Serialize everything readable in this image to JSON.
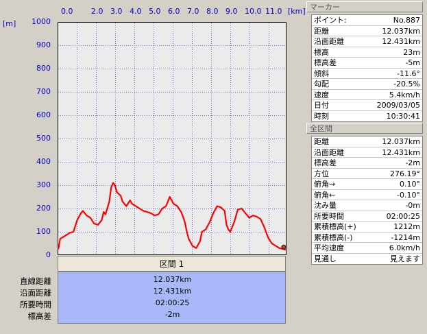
{
  "chart": {
    "unit_x": "[km]",
    "unit_y": "[m]",
    "x_ticks": [
      "0.0",
      "2.0",
      "3.0",
      "4.0",
      "5.0",
      "6.0",
      "7.0",
      "8.0",
      "9.0",
      "10.0",
      "11.0"
    ],
    "y_ticks": [
      "1000",
      "900",
      "800",
      "700",
      "600",
      "500",
      "400",
      "300",
      "200",
      "100",
      "0"
    ],
    "line_color": "#ff0000",
    "grid_color": "#6f6fd8",
    "plot_bg": "#ebebeb"
  },
  "chart_data": {
    "type": "line",
    "xlabel": "[km]",
    "ylabel": "[m]",
    "ylim": [
      0,
      1000
    ],
    "xlim": [
      0,
      12.037
    ],
    "x": [
      0.0,
      0.1,
      0.3,
      0.6,
      0.8,
      1.0,
      1.2,
      1.3,
      1.5,
      1.7,
      1.9,
      2.1,
      2.3,
      2.4,
      2.5,
      2.7,
      2.8,
      2.9,
      3.0,
      3.1,
      3.3,
      3.4,
      3.6,
      3.8,
      3.9,
      4.1,
      4.3,
      4.5,
      4.7,
      4.9,
      5.1,
      5.3,
      5.5,
      5.7,
      5.9,
      6.1,
      6.3,
      6.5,
      6.6,
      6.7,
      6.8,
      6.9,
      7.1,
      7.3,
      7.5,
      7.6,
      7.7,
      7.8,
      8.0,
      8.2,
      8.4,
      8.6,
      8.8,
      8.9,
      9.0,
      9.1,
      9.3,
      9.5,
      9.7,
      9.9,
      10.1,
      10.3,
      10.5,
      10.7,
      10.9,
      11.1,
      11.3,
      11.5,
      11.7,
      11.9,
      12.037
    ],
    "y": [
      25,
      70,
      80,
      95,
      100,
      150,
      180,
      190,
      170,
      160,
      135,
      130,
      150,
      185,
      175,
      230,
      290,
      310,
      300,
      270,
      255,
      230,
      210,
      235,
      220,
      210,
      200,
      190,
      185,
      180,
      170,
      175,
      200,
      210,
      250,
      220,
      210,
      185,
      165,
      140,
      100,
      70,
      40,
      30,
      60,
      100,
      105,
      110,
      140,
      180,
      210,
      205,
      190,
      130,
      110,
      100,
      140,
      195,
      200,
      180,
      160,
      170,
      165,
      155,
      120,
      75,
      50,
      40,
      30,
      26,
      23
    ],
    "series": []
  },
  "marker": {
    "header": "マーカー",
    "rows": [
      {
        "k": "ポイント:",
        "v": "No.887"
      },
      {
        "k": "距離",
        "v": "12.037km"
      },
      {
        "k": "沿面距離",
        "v": "12.431km"
      },
      {
        "k": "標高",
        "v": "23m"
      },
      {
        "k": "標高差",
        "v": "-5m"
      },
      {
        "k": "傾斜",
        "v": "-11.6°"
      },
      {
        "k": "勾配",
        "v": "-20.5%"
      },
      {
        "k": "速度",
        "v": "5.4km/h"
      },
      {
        "k": "日付",
        "v": "2009/03/05"
      },
      {
        "k": "時刻",
        "v": "10:30:41"
      }
    ]
  },
  "total": {
    "header": "全区間",
    "rows": [
      {
        "k": "距離",
        "v": "12.037km"
      },
      {
        "k": "沿面距離",
        "v": "12.431km"
      },
      {
        "k": "標高差",
        "v": "-2m"
      },
      {
        "k": "方位",
        "v": "276.19°"
      },
      {
        "k": "俯角→",
        "v": "0.10°"
      },
      {
        "k": "俯角←",
        "v": "-0.10°"
      },
      {
        "k": "沈み量",
        "v": "-0m"
      },
      {
        "k": "所要時間",
        "v": "02:00:25"
      },
      {
        "k": "累積標高(+)",
        "v": "1212m"
      },
      {
        "k": "累積標高(-)",
        "v": "-1214m"
      },
      {
        "k": "平均速度",
        "v": "6.0km/h"
      },
      {
        "k": "見通し",
        "v": "見えます"
      }
    ]
  },
  "section": {
    "button_label": "区間 1",
    "labels": [
      "直線距離",
      "沿面距離",
      "所要時間",
      "標高差"
    ],
    "values": [
      "12.037km",
      "12.431km",
      "02:00:25",
      "-2m"
    ]
  }
}
